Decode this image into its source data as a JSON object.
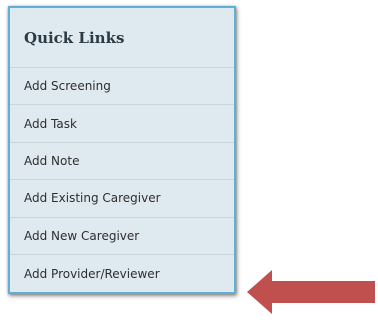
{
  "quick_links": {
    "title": "Quick Links",
    "items": [
      {
        "label": "Add Screening"
      },
      {
        "label": "Add Task"
      },
      {
        "label": "Add Note"
      },
      {
        "label": "Add Existing Caregiver"
      },
      {
        "label": "Add New Caregiver"
      },
      {
        "label": "Add Provider/Reviewer"
      }
    ]
  },
  "annotation": {
    "arrow_color": "#c0504d",
    "arrow_direction": "left",
    "arrow_target": "Add Provider/Reviewer"
  },
  "colors": {
    "panel_background": "#dfeaf0",
    "panel_border": "#5fb0d3",
    "divider": "#c9d6dd"
  }
}
